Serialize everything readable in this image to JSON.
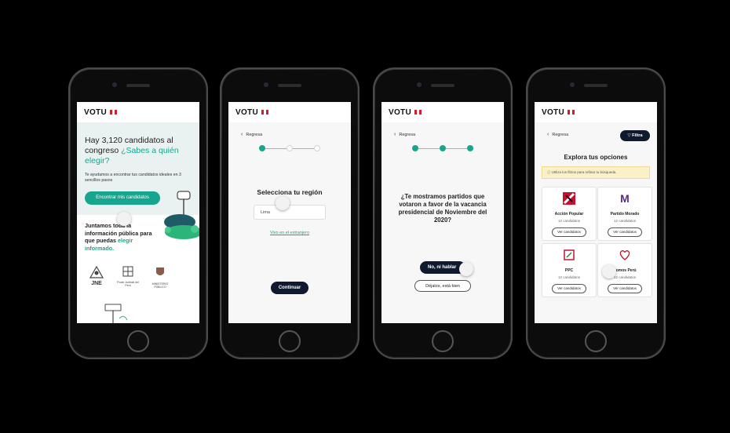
{
  "brand": {
    "logo": "VOTU",
    "accent": "#17a58e",
    "dark": "#0f1a2e"
  },
  "screen1": {
    "headline_part1": "Hay 3,120 candidatos al congreso",
    "headline_part2": "¿Sabes a quién elegir?",
    "subtext": "Te ayudamos a encontrar tus candidatos ideales en 3 sencillos pasos",
    "cta": "Encontrar mis candidatos",
    "info_part1": "Juntamos toda la información pública para que puedas",
    "info_part2": "elegir informado.",
    "partners": [
      "JNE",
      "Poder Judicial del Perú",
      "MINISTERIO PÚBLICO"
    ]
  },
  "screen2": {
    "back": "Regresa",
    "title": "Selecciona tu región",
    "input_value": "Lima",
    "abroad_link": "Vivo en el extranjero",
    "continue": "Continuar",
    "steps": [
      true,
      false,
      false
    ]
  },
  "screen3": {
    "back": "Regresa",
    "question": "¿Te mostramos partidos que votaron a favor de la vacancia presidencial de Noviembre del 2020?",
    "option_no": "No, ni hablar",
    "option_ok": "Déjalos, está bien",
    "steps": [
      true,
      true,
      true
    ]
  },
  "screen4": {
    "back": "Regresa",
    "filter": "Filtra",
    "title": "Explora tus opciones",
    "notice": "Utiliza los filtros para refinar tu búsqueda.",
    "view_label": "Ver candidatos",
    "parties": [
      {
        "name": "Acción Popular",
        "count": "12 candidatos",
        "logo": "ap-logo"
      },
      {
        "name": "Partido Morado",
        "count": "12 candidatos",
        "logo": "pm-logo",
        "color": "#5b2a86"
      },
      {
        "name": "PPC",
        "count": "12 candidatos",
        "logo": "ppc-logo"
      },
      {
        "name": "Somos Perú",
        "count": "12 candidatos",
        "logo": "sp-logo"
      }
    ]
  }
}
